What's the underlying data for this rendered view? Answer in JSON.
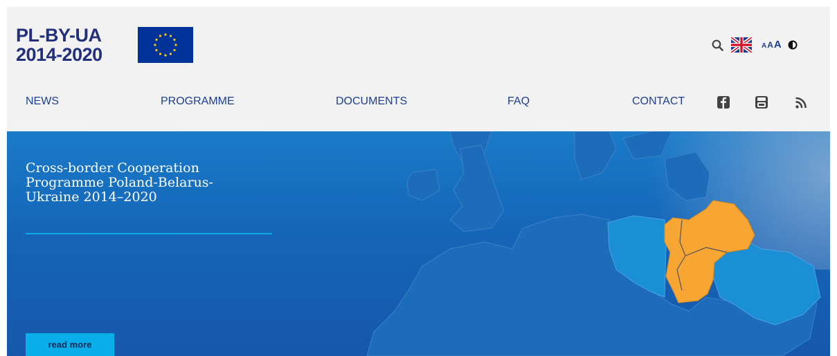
{
  "header": {
    "logo": {
      "line1": "PL-BY-UA",
      "line2": "2014-2020"
    },
    "eu_flag_icon": "eu-flag",
    "tools": {
      "search_icon": "search-icon",
      "language_icon": "uk-flag-icon",
      "font_sizes": [
        "A",
        "A",
        "A"
      ],
      "contrast_icon": "contrast-icon"
    }
  },
  "nav": {
    "items": [
      "NEWS",
      "PROGRAMME",
      "DOCUMENTS",
      "FAQ",
      "CONTACT"
    ],
    "social": [
      "facebook-icon",
      "youtube-icon",
      "rss-icon"
    ]
  },
  "hero": {
    "title_lines": [
      "Cross-border Cooperation",
      "Programme Poland-Belarus-",
      "Ukraine 2014–2020"
    ],
    "button_label": "read more"
  },
  "colors": {
    "header_bg": "#f2f2f2",
    "brand_navy": "#22307c",
    "nav_text": "#1d3f8f",
    "hero_blue": "#1565b8",
    "map_land": "#1c6dbb",
    "highlight_light": "#1b8fd6",
    "highlight_orange": "#f7a533",
    "accent_cyan": "#0aaeea"
  }
}
